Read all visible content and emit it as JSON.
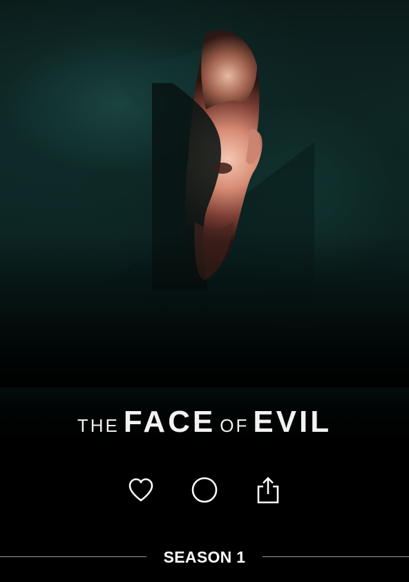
{
  "show": {
    "title_parts": [
      "THE",
      "FACE",
      "OF",
      "EVIL"
    ]
  },
  "actions": [
    {
      "id": "like",
      "icon": "heart-icon"
    },
    {
      "id": "watched",
      "icon": "circle-icon"
    },
    {
      "id": "share",
      "icon": "share-icon"
    }
  ],
  "season": {
    "label": "SEASON 1"
  },
  "colors": {
    "background": "#000000",
    "teal_glow": "#1c4844",
    "text": "#f2f2f2",
    "divider": "#9a9a9a"
  }
}
